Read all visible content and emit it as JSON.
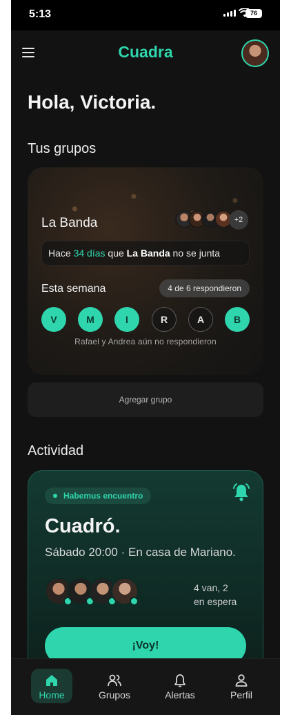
{
  "status_bar": {
    "time": "5:13",
    "battery": "76"
  },
  "header": {
    "app_name": "Cuadra"
  },
  "greeting": "Hola, Victoria.",
  "groups_section": {
    "title": "Tus grupos"
  },
  "group_card": {
    "name": "La Banda",
    "extra_members": "+2",
    "since": {
      "prefix": "Hace ",
      "days": "34 días",
      "middle": " que ",
      "group": "La Banda",
      "suffix": " no se junta"
    },
    "week_label": "Esta semana",
    "responded": "4 de 6 respondieron",
    "days": [
      {
        "letter": "V",
        "selected": true
      },
      {
        "letter": "M",
        "selected": true
      },
      {
        "letter": "I",
        "selected": true
      },
      {
        "letter": "R",
        "selected": false
      },
      {
        "letter": "A",
        "selected": false
      },
      {
        "letter": "B",
        "selected": true
      }
    ],
    "pending_text": "Rafael y Andrea aún no respondieron"
  },
  "add_group_label": "Agregar grupo",
  "activity_section": {
    "title": "Actividad"
  },
  "activity_card": {
    "tag": "Habemus encuentro",
    "title": "Cuadró.",
    "subtitle": "Sábado 20:00 · En casa de Mariano.",
    "attendance_line1": "4 van, 2",
    "attendance_line2": "en espera",
    "cta": "¡Voy!"
  },
  "bottom_nav": [
    {
      "label": "Home",
      "icon": "home-icon",
      "active": true
    },
    {
      "label": "Grupos",
      "icon": "users-icon",
      "active": false
    },
    {
      "label": "Alertas",
      "icon": "bell-icon",
      "active": false
    },
    {
      "label": "Perfil",
      "icon": "user-icon",
      "active": false
    }
  ],
  "colors": {
    "accent": "#2fd6ad",
    "background": "#121212",
    "card": "#1e1e1e"
  }
}
